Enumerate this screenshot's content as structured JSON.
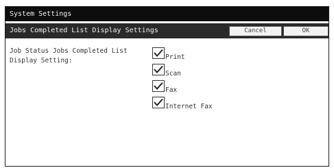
{
  "window": {
    "title": "System Settings"
  },
  "header": {
    "title": "Jobs Completed List Display Settings",
    "cancel_label": "Cancel",
    "ok_label": "OK"
  },
  "setting": {
    "label": "Job Status Jobs Completed List\nDisplay Setting:"
  },
  "options": [
    {
      "label": "Print",
      "checked": true
    },
    {
      "label": "Scan",
      "checked": true
    },
    {
      "label": "Fax",
      "checked": true
    },
    {
      "label": "Internet Fax",
      "checked": true
    }
  ]
}
